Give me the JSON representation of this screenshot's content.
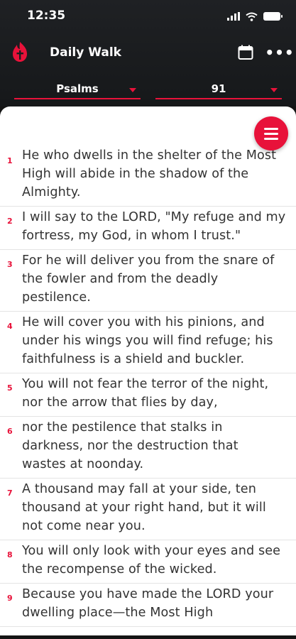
{
  "status_bar": {
    "time": "12:35",
    "icons": [
      "signal-icon",
      "wifi-icon",
      "battery-icon"
    ]
  },
  "header": {
    "title": "Daily Walk",
    "logo": "flame-logo",
    "actions": [
      "calendar-icon",
      "more-icon"
    ],
    "more_label": "•••"
  },
  "selectors": {
    "book": "Psalms",
    "chapter": "91"
  },
  "colors": {
    "accent": "#e8123a",
    "header_bg": "#1c1e20",
    "text": "#333333"
  },
  "fab": {
    "icon": "menu-icon"
  },
  "verses": [
    {
      "num": "1",
      "text": "He who dwells in the shelter of the Most High will abide in the shadow of the Almighty."
    },
    {
      "num": "2",
      "text": "I will say to the LORD, \"My refuge and my fortress, my God, in whom I trust.\""
    },
    {
      "num": "3",
      "text": "For he will deliver you from the snare of the fowler and from the deadly pestilence."
    },
    {
      "num": "4",
      "text": "He will cover you with his pinions, and under his wings you will find refuge; his faithfulness is a shield and buckler."
    },
    {
      "num": "5",
      "text": "You will not fear the terror of the night, nor the arrow that flies by day,"
    },
    {
      "num": "6",
      "text": "nor the pestilence that stalks in darkness, nor the destruction that wastes at noonday."
    },
    {
      "num": "7",
      "text": "A thousand may fall at your side, ten thousand at your right hand, but it will not come near you."
    },
    {
      "num": "8",
      "text": "You will only look with your eyes and see the recompense of the wicked."
    },
    {
      "num": "9",
      "text": "Because you have made the LORD your dwelling place—the Most High"
    }
  ]
}
